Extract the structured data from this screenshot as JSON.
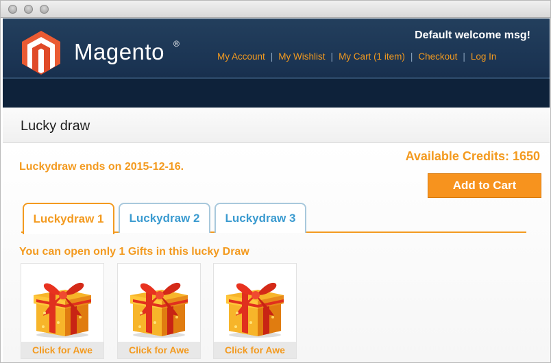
{
  "window": {
    "controls": [
      "close",
      "minimize",
      "zoom"
    ]
  },
  "header": {
    "logo_text": "Magento",
    "logo_reg": "®",
    "welcome": "Default welcome msg!",
    "links": [
      {
        "label": "My Account"
      },
      {
        "label": "My Wishlist"
      },
      {
        "label": "My Cart (1 item)"
      },
      {
        "label": "Checkout"
      },
      {
        "label": "Log In"
      }
    ],
    "separator": "|"
  },
  "page": {
    "title": "Lucky draw",
    "ends_text": "Luckydraw ends on 2015-12-16.",
    "credits_text": "Available Credits: 1650",
    "add_to_cart_label": "Add to Cart",
    "tabs": [
      {
        "label": "Luckydraw 1",
        "active": true
      },
      {
        "label": "Luckydraw 2",
        "active": false
      },
      {
        "label": "Luckydraw 3",
        "active": false
      }
    ],
    "open_note": "You can open only 1 Gifts in this lucky Draw",
    "gifts": [
      {
        "label": "Click for Awe",
        "icon": "gift-box-icon"
      },
      {
        "label": "Click for Awe",
        "icon": "gift-box-icon"
      },
      {
        "label": "Click for Awe",
        "icon": "gift-box-icon"
      }
    ]
  },
  "colors": {
    "accent": "#f39a1f",
    "header_bg": "#1a3352",
    "tab_inactive": "#3b9bd0",
    "logo_red": "#e04a28"
  }
}
